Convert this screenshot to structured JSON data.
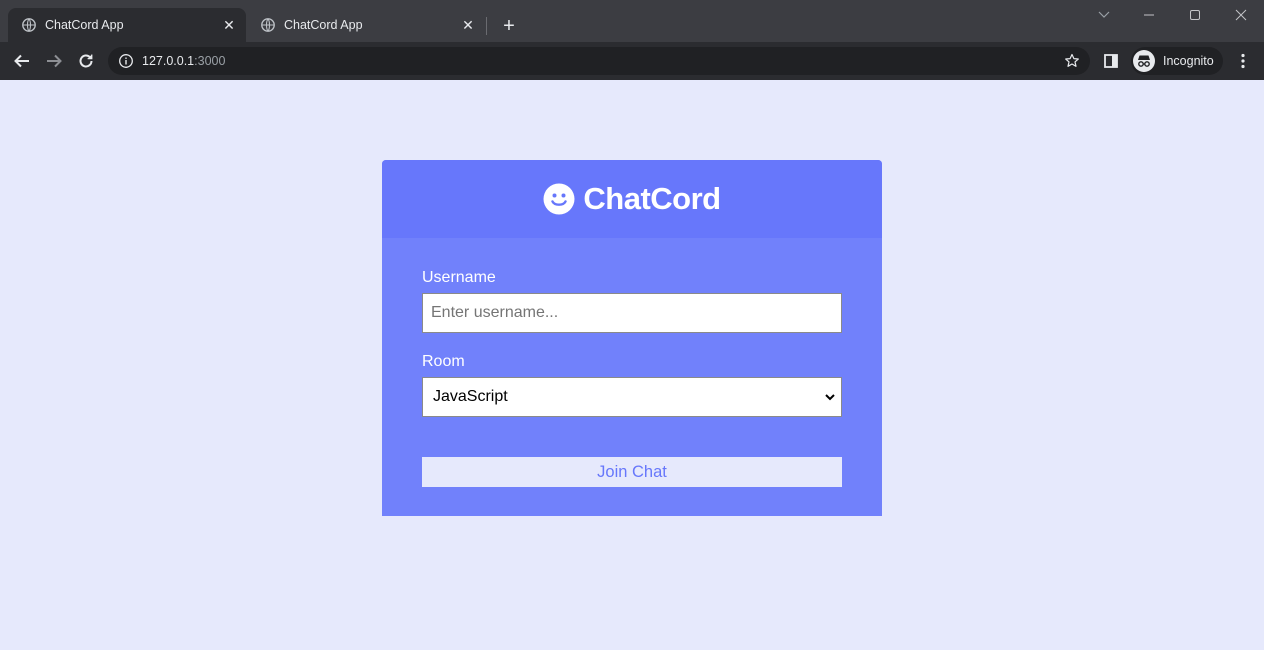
{
  "browser": {
    "tabs": [
      {
        "title": "ChatCord App",
        "close": "✕",
        "active": true
      },
      {
        "title": "ChatCord App",
        "close": "✕",
        "active": false
      }
    ],
    "new_tab": "+",
    "url_host": "127.0.0.1",
    "url_port": ":3000",
    "profile_label": "Incognito"
  },
  "page": {
    "brand": "ChatCord",
    "username_label": "Username",
    "username_placeholder": "Enter username...",
    "room_label": "Room",
    "room_selected": "JavaScript",
    "join_label": "Join Chat"
  },
  "colors": {
    "page_bg": "#e6e9fc",
    "card_header": "#6777fb",
    "card_body": "#7181fb",
    "button_text": "#6777fb"
  }
}
